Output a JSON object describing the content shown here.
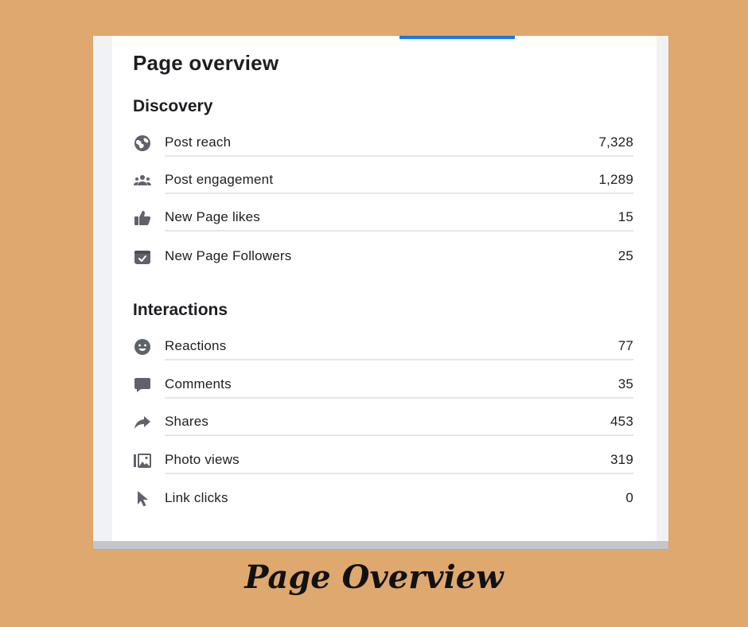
{
  "title": "Page overview",
  "caption": "Page Overview",
  "accent": "#1877f2",
  "sections": {
    "discovery": {
      "title": "Discovery",
      "rows": [
        {
          "label": "Post reach",
          "value": "7,328",
          "icon": "globe-icon"
        },
        {
          "label": "Post engagement",
          "value": "1,289",
          "icon": "people-icon"
        },
        {
          "label": "New Page likes",
          "value": "15",
          "icon": "thumbs-up-icon"
        },
        {
          "label": "New Page Followers",
          "value": "25",
          "icon": "follow-checkmark-icon"
        }
      ]
    },
    "interactions": {
      "title": "Interactions",
      "rows": [
        {
          "label": "Reactions",
          "value": "77",
          "icon": "smiley-icon"
        },
        {
          "label": "Comments",
          "value": "35",
          "icon": "comment-bubble-icon"
        },
        {
          "label": "Shares",
          "value": "453",
          "icon": "share-arrow-icon"
        },
        {
          "label": "Photo views",
          "value": "319",
          "icon": "photo-icon"
        },
        {
          "label": "Link clicks",
          "value": "0",
          "icon": "cursor-icon"
        }
      ]
    }
  }
}
